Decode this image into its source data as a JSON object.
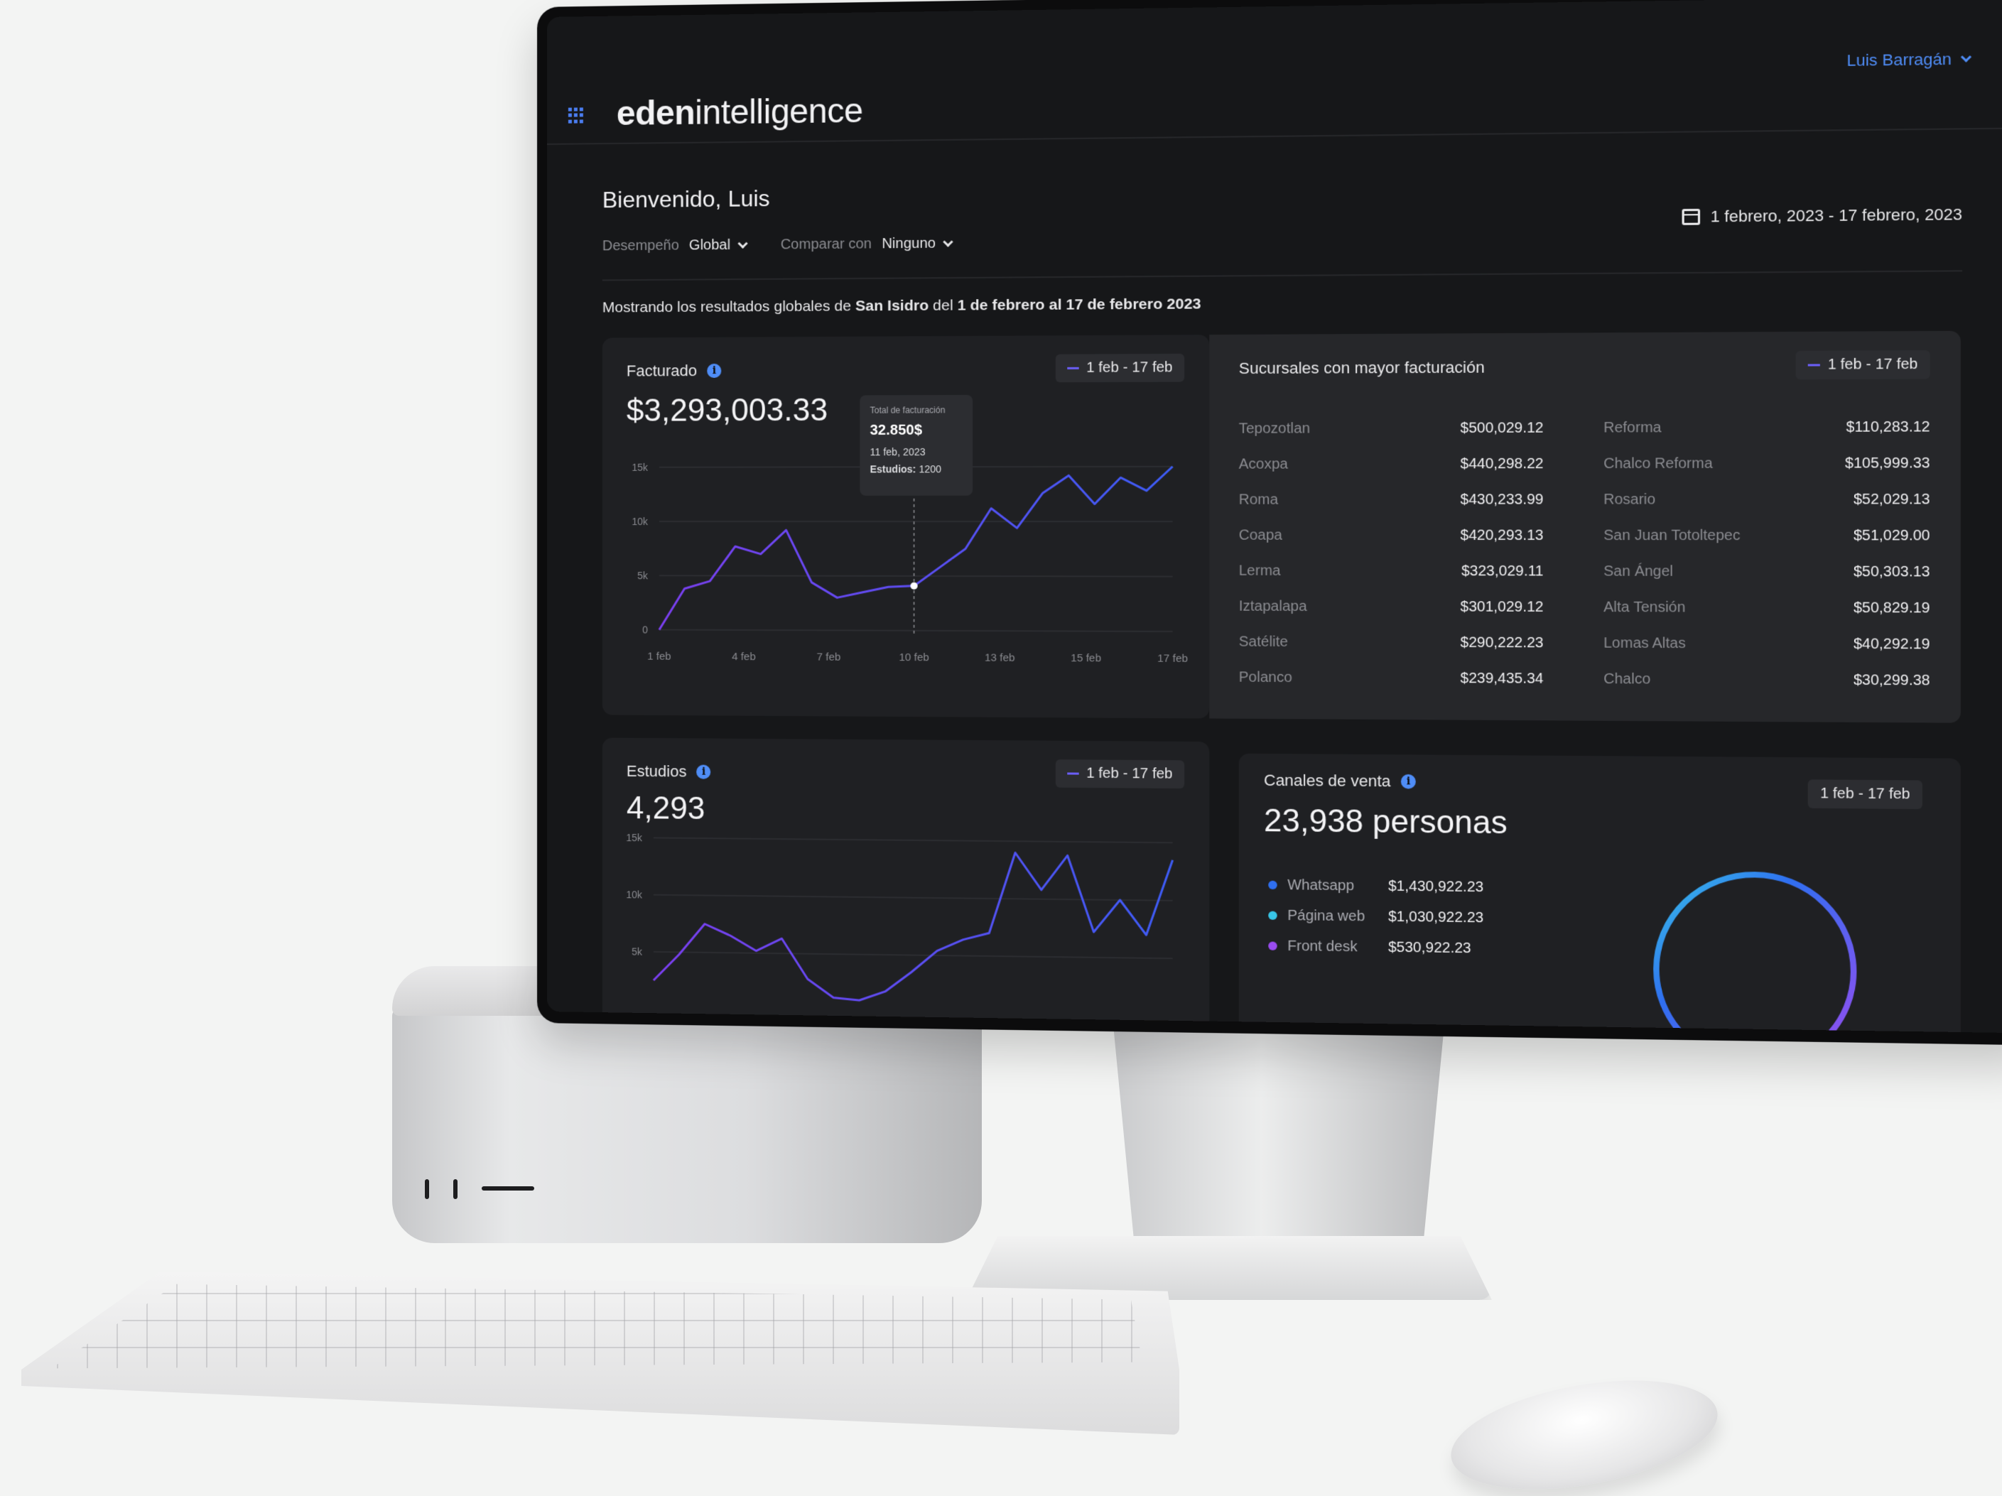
{
  "app": {
    "brand_bold": "eden",
    "brand_light": "intelligence",
    "user_name": "Luis Barragán"
  },
  "header": {
    "welcome": "Bienvenido, Luis",
    "performance_label": "Desempeño",
    "performance_value": "Global",
    "compare_label": "Comparar con",
    "compare_value": "Ninguno",
    "date_range": "1 febrero, 2023 - 17 febrero, 2023"
  },
  "summary": {
    "prefix": "Mostrando los resultados globales de ",
    "branch": "San Isidro",
    "middle": " del ",
    "period": "1 de febrero al 17 de febrero 2023"
  },
  "billing_card": {
    "title": "Facturado",
    "value": "$3,293,003.33",
    "range_pill": "1 feb - 17 feb",
    "tooltip": {
      "heading": "Total de facturación",
      "amount": "32.850$",
      "date": "11 feb, 2023",
      "studies_label": "Estudios:",
      "studies_value": "1200"
    }
  },
  "branches_card": {
    "title": "Sucursales con mayor facturación",
    "range_pill": "1 feb - 17 feb",
    "left": [
      {
        "name": "Tepozotlan",
        "value": "$500,029.12"
      },
      {
        "name": "Acoxpa",
        "value": "$440,298.22"
      },
      {
        "name": "Roma",
        "value": "$430,233.99"
      },
      {
        "name": "Coapa",
        "value": "$420,293.13"
      },
      {
        "name": "Lerma",
        "value": "$323,029.11"
      },
      {
        "name": "Iztapalapa",
        "value": "$301,029.12"
      },
      {
        "name": "Satélite",
        "value": "$290,222.23"
      },
      {
        "name": "Polanco",
        "value": "$239,435.34"
      }
    ],
    "right": [
      {
        "name": "Reforma",
        "value": "$110,283.12"
      },
      {
        "name": "Chalco Reforma",
        "value": "$105,999.33"
      },
      {
        "name": "Rosario",
        "value": "$52,029.13"
      },
      {
        "name": "San Juan Totoltepec",
        "value": "$51,029.00"
      },
      {
        "name": "San Ángel",
        "value": "$50,303.13"
      },
      {
        "name": "Alta Tensión",
        "value": "$50,829.19"
      },
      {
        "name": "Lomas Altas",
        "value": "$40,292.19"
      },
      {
        "name": "Chalco",
        "value": "$30,299.38"
      }
    ]
  },
  "studies_card": {
    "title": "Estudios",
    "value": "4,293",
    "range_pill": "1 feb - 17 feb"
  },
  "channels_card": {
    "title": "Canales de venta",
    "value": "23,938 personas",
    "range_pill": "1 feb - 17 feb",
    "items": [
      {
        "name": "Whatsapp",
        "value": "$1,430,922.23",
        "color": "#2f6ff0"
      },
      {
        "name": "Página web",
        "value": "$1,030,922.23",
        "color": "#38c6e8"
      },
      {
        "name": "Front desk",
        "value": "$530,922.23",
        "color": "#9a4cf0"
      }
    ]
  },
  "chart_data": [
    {
      "type": "line",
      "ylim": [
        0,
        15000
      ],
      "y_ticks": [
        "0",
        "5k",
        "10k",
        "15k"
      ],
      "x_ticks": [
        "1 feb",
        "4 feb",
        "7 feb",
        "10 feb",
        "13 feb",
        "15 feb",
        "17 feb"
      ],
      "x": [
        1,
        2,
        3,
        4,
        5,
        6,
        7,
        8,
        9,
        10,
        11,
        12,
        13,
        14,
        15,
        16,
        17,
        18,
        19,
        20,
        21
      ],
      "series": [
        {
          "values": [
            0,
            3800,
            4500,
            7700,
            7000,
            9200,
            4400,
            3000,
            3500,
            4000,
            4100,
            5800,
            7500,
            11200,
            9400,
            12600,
            14200,
            11600,
            14000,
            12800,
            15000
          ]
        }
      ],
      "colors": [
        "#7b3ff0",
        "#3d5cf5"
      ]
    },
    {
      "type": "line",
      "ylim": [
        0,
        15000
      ],
      "y_ticks": [
        "5k",
        "10k",
        "15k"
      ],
      "x": [
        1,
        2,
        3,
        4,
        5,
        6,
        7,
        8,
        9,
        10,
        11,
        12,
        13,
        14,
        15,
        16,
        17,
        18,
        19,
        20,
        21
      ],
      "series": [
        {
          "values": [
            2500,
            4800,
            7500,
            6500,
            5200,
            6300,
            2800,
            1200,
            1000,
            1800,
            3500,
            5400,
            6400,
            7000,
            14000,
            10800,
            13800,
            7200,
            10000,
            7000,
            13500
          ]
        }
      ],
      "colors": [
        "#7b3ff0",
        "#3d5cf5"
      ]
    }
  ]
}
